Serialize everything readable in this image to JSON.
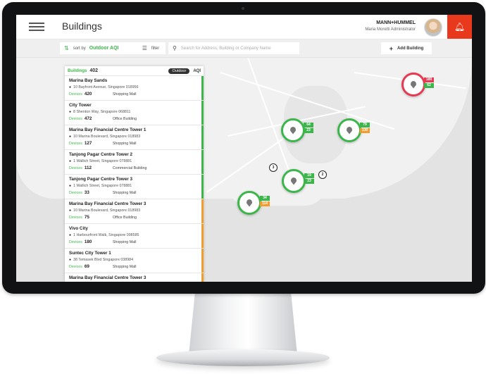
{
  "header": {
    "title": "Buildings",
    "brand": "MANN+HUMMEL",
    "user": "Maria Moretti Administrator"
  },
  "toolbar": {
    "sort_label": "sort by",
    "sort_value": "Outdoor AQI",
    "filter_label": "filter",
    "search_placeholder": "Search for Address, Building or Company Name",
    "add_label": "Add Building"
  },
  "panel": {
    "buildings_label": "Buildings",
    "count": "402",
    "segment": "Outdoor",
    "aqi": "AQI"
  },
  "list": [
    {
      "name": "Marina Bay Sands",
      "address": "10 Bayfront Avenue, Singapore 018956",
      "devices_label": "Devices",
      "devices": "420",
      "type": "Shopping Mall",
      "status": "#3cb64a"
    },
    {
      "name": "City Tower",
      "address": "8 Shenton Way, Singapore 068811",
      "devices_label": "Devices",
      "devices": "472",
      "type": "Office Building",
      "status": "#3cb64a"
    },
    {
      "name": "Marina Bay Financial Centre Tower 1",
      "address": "10 Marina Boulevard, Singapore 018983",
      "devices_label": "Devices",
      "devices": "127",
      "type": "Shopping Mall",
      "status": "#3cb64a"
    },
    {
      "name": "Tanjong Pagar Centre Tower 2",
      "address": "1 Wallich Street, Singapore 078881",
      "devices_label": "Devices",
      "devices": "112",
      "type": "Commercial Building",
      "status": "#3cb64a"
    },
    {
      "name": "Tanjong Pagar Centre Tower 3",
      "address": "1 Wallich Street, Singapore 078881",
      "devices_label": "Devices",
      "devices": "33",
      "type": "Shopping Mall",
      "status": "#3cb64a"
    },
    {
      "name": "Marina Bay Financial Centre Tower 3",
      "address": "10 Marina Boulevard, Singapore 018983",
      "devices_label": "Devices",
      "devices": "75",
      "type": "Office Building",
      "status": "#f39c2e"
    },
    {
      "name": "Vivo City",
      "address": "1 Harbourfront Walk, Singapore 098585",
      "devices_label": "Devices",
      "devices": "180",
      "type": "Shopping Mall",
      "status": "#f39c2e"
    },
    {
      "name": "Suntec City Tower 1",
      "address": "38 Temasek Blvd Singapore 038984",
      "devices_label": "Devices",
      "devices": "69",
      "type": "Shopping Mall",
      "status": "#f39c2e"
    },
    {
      "name": "Marina Bay Financial Centre Tower 3",
      "address": "",
      "devices_label": "",
      "devices": "",
      "type": "",
      "status": "#f39c2e"
    }
  ],
  "markers": [
    {
      "top": "64",
      "bottom": "23"
    },
    {
      "top": "79",
      "bottom": "130"
    },
    {
      "top": "19",
      "bottom": "23"
    },
    {
      "top": "34",
      "bottom": "114"
    },
    {
      "top": "189",
      "bottom": "62"
    }
  ],
  "clusters": [
    "3",
    "2"
  ]
}
